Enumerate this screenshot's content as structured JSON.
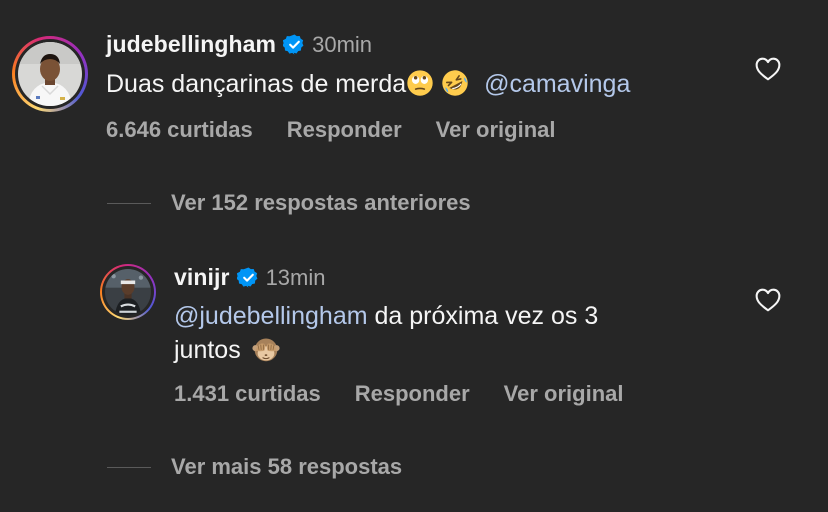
{
  "comments": [
    {
      "username": "judebellingham",
      "verified": true,
      "time": "30min",
      "text": "Duas dançarinas de merda",
      "emojis": [
        "face-with-rolling-eyes",
        "rolling-on-floor-laughing"
      ],
      "mention": "@camavinga",
      "likes": "6.646 curtidas",
      "reply_label": "Responder",
      "original_label": "Ver original"
    },
    {
      "username": "vinijr",
      "verified": true,
      "time": "13min",
      "mention": "@judebellingham",
      "text_line1": "da próxima vez os 3",
      "text_line2": "juntos",
      "emojis": [
        "see-no-evil-monkey"
      ],
      "likes": "1.431 curtidas",
      "reply_label": "Responder",
      "original_label": "Ver original"
    }
  ],
  "view_previous_replies": "Ver 152 respostas anteriores",
  "view_more_replies": "Ver mais 58 respostas",
  "colors": {
    "background": "#262626",
    "text": "#f5f5f5",
    "muted": "#a8a8a8",
    "mention": "#b4c8ea",
    "verified": "#0095f6"
  },
  "icons": [
    "verified-badge-icon",
    "heart-outline-icon"
  ]
}
